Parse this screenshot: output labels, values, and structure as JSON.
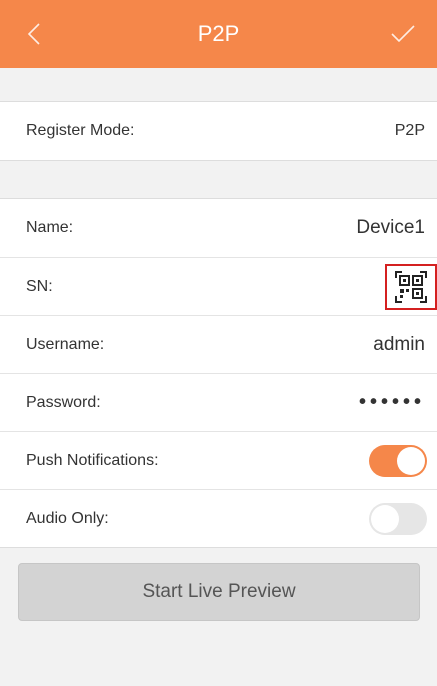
{
  "header": {
    "title": "P2P",
    "back_icon": "chevron-left-icon",
    "confirm_icon": "checkmark-icon",
    "color": "#f5874a"
  },
  "register": {
    "label": "Register Mode:",
    "value": "P2P"
  },
  "fields": {
    "name": {
      "label": "Name:",
      "value": "Device1"
    },
    "sn": {
      "label": "SN:",
      "icon": "qr-code-icon"
    },
    "username": {
      "label": "Username:",
      "value": "admin"
    },
    "password": {
      "label": "Password:",
      "value": "••••••"
    },
    "push": {
      "label": "Push Notifications:",
      "enabled": true
    },
    "audio": {
      "label": "Audio Only:",
      "enabled": false
    }
  },
  "preview_button": {
    "label": "Start Live Preview"
  },
  "colors": {
    "accent": "#f5874a",
    "highlight": "#d42020",
    "toggle_off": "#e6e6e6"
  }
}
